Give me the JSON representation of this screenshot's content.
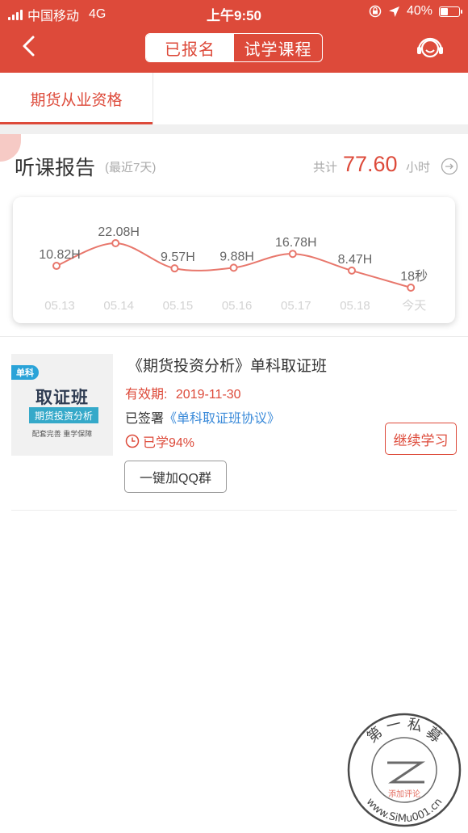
{
  "status": {
    "carrier": "中国移动",
    "network": "4G",
    "time": "上午9:50",
    "battery": "40%"
  },
  "nav": {
    "tab_enrolled": "已报名",
    "tab_trial": "试学课程",
    "back_icon": "chevron-left-icon",
    "service_icon": "headset-icon"
  },
  "subtab": {
    "label": "期货从业资格"
  },
  "report": {
    "title": "听课报告",
    "subtitle": "(最近7天)",
    "total_label": "共计",
    "total_value": "77.60",
    "total_unit": "小时",
    "arrow_icon": "circle-arrow-right-icon"
  },
  "chart_data": {
    "type": "line",
    "categories": [
      "05.13",
      "05.14",
      "05.15",
      "05.16",
      "05.17",
      "05.18",
      "今天"
    ],
    "value_labels": [
      "10.82H",
      "22.08H",
      "9.57H",
      "9.88H",
      "16.78H",
      "8.47H",
      "18秒"
    ],
    "values_hours": [
      10.82,
      22.08,
      9.57,
      9.88,
      16.78,
      8.47,
      0.005
    ],
    "color": "#e8776c"
  },
  "course": {
    "thumb": {
      "badge": "单科",
      "big": "取证班",
      "blue": "期货投资分析",
      "tiny": "配套完善 重学保障"
    },
    "title": "《期货投资分析》单科取证班",
    "valid_label": "有效期:",
    "valid_date": "2019-11-30",
    "signed_prefix": "已签署",
    "signed_link": "《单科取证班协议》",
    "progress": "已学94%",
    "continue_label": "继续学习",
    "qq_label": "一键加QQ群"
  },
  "watermark": {
    "top_text": "第 一 私 募",
    "url_text": "www.SiMu001.cn",
    "inner_text": "添加评论"
  },
  "colors": {
    "brand": "#dd4a3a",
    "link": "#3a8ad9"
  }
}
